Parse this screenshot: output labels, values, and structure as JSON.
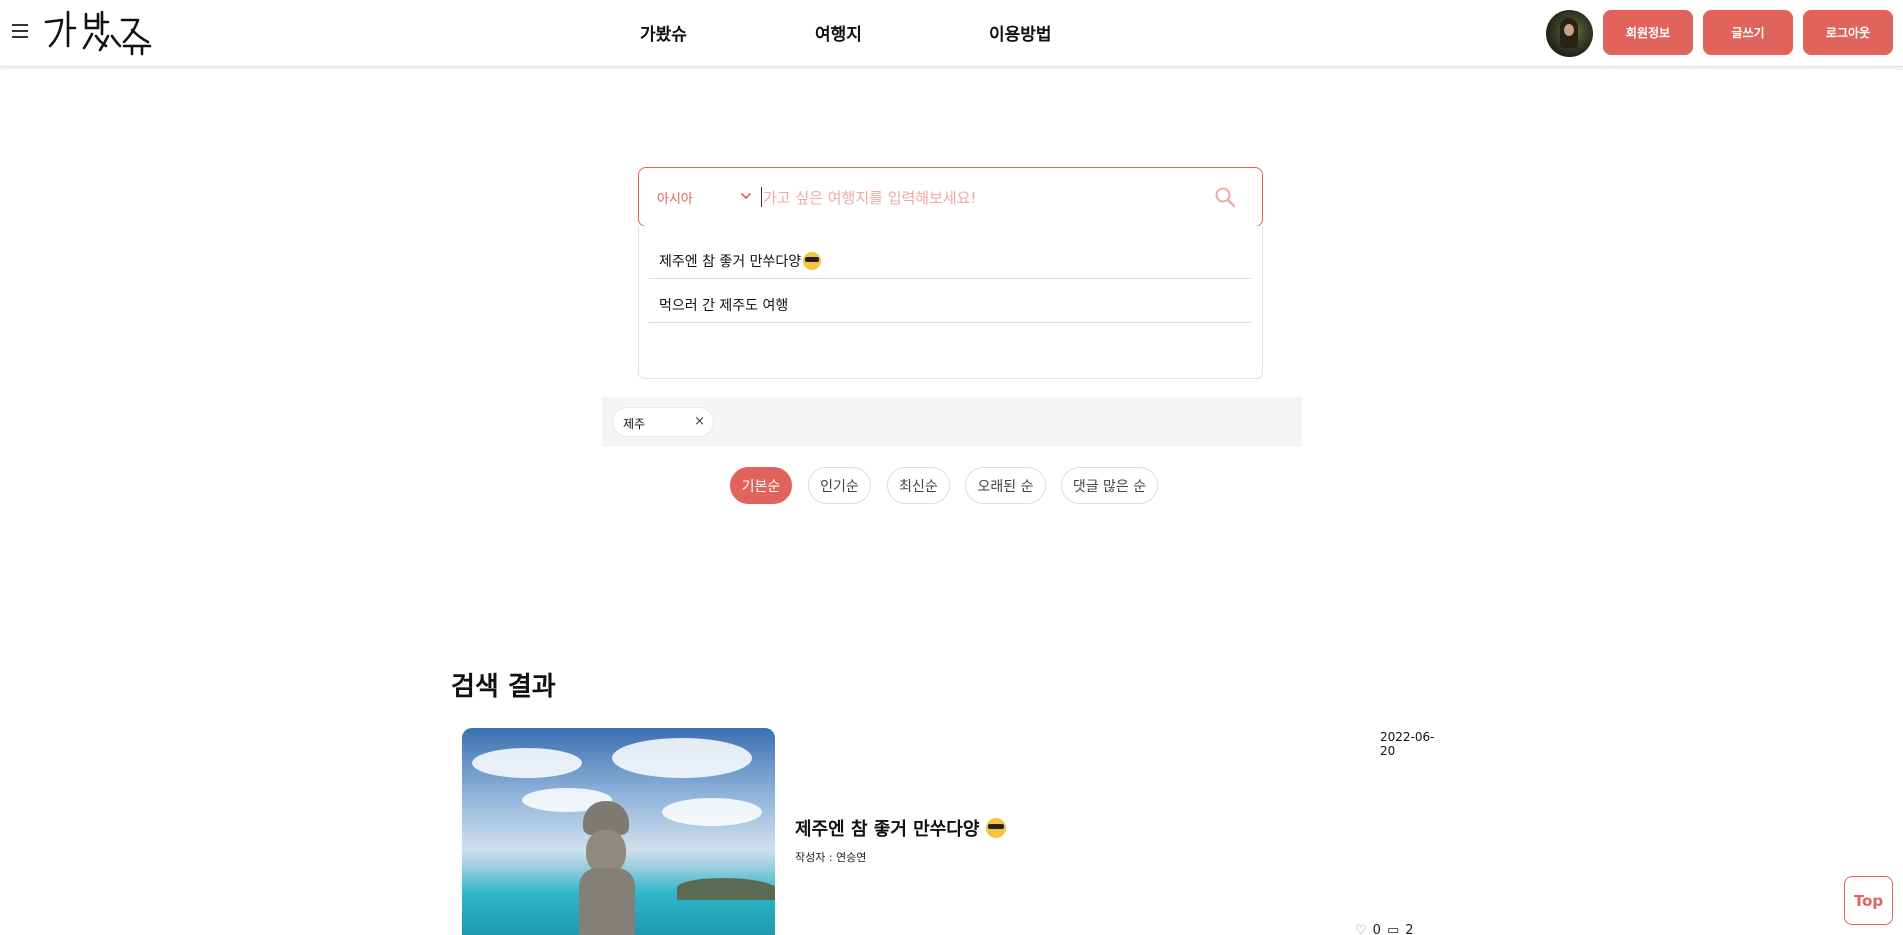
{
  "header": {
    "logo_text": "가봤슈",
    "nav": [
      "가봤슈",
      "여행지",
      "이용방법"
    ],
    "buttons": {
      "profile": "회원정보",
      "write": "글쓰기",
      "logout": "로그아웃"
    }
  },
  "search": {
    "region": "아시아",
    "placeholder": "가고 싶은 여행지를 입력해보세요!",
    "value": "",
    "suggestions": [
      {
        "text": "제주엔 참 좋거 만쑤다양",
        "emoji": "smiling-face-with-sunglasses-icon"
      },
      {
        "text": "먹으러 간 제주도 여행",
        "emoji": ""
      }
    ]
  },
  "tags": [
    {
      "label": "제주",
      "remove": "×"
    }
  ],
  "sort": {
    "options": [
      "기본순",
      "인기순",
      "최신순",
      "오래된 순",
      "댓글 많은 순"
    ],
    "active": "기본순"
  },
  "results": {
    "title": "검색 결과",
    "items": [
      {
        "date": "2022-06-20",
        "title": "제주엔 참 좋거 만쑤다양",
        "title_emoji": "smiling-face-with-sunglasses-icon",
        "author": "작성자 : 연승연",
        "likes": "0",
        "comments": "2",
        "image": "dol-hareubang-statue-by-sea"
      }
    ]
  },
  "top_button": "Top",
  "colors": {
    "accent": "#e0645c",
    "tag_bar_bg": "#f5f5f5",
    "placeholder": "#f0a9a4"
  }
}
